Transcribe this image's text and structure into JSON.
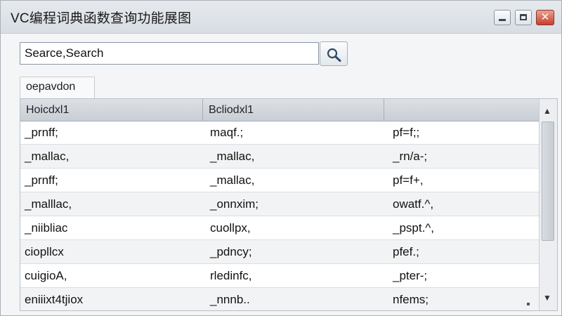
{
  "window": {
    "title": "VC编程词典函数查询功能展图"
  },
  "search": {
    "value": "Searce,Search",
    "placeholder": ""
  },
  "icons": {
    "search_button": "search-icon",
    "minimize": "minimize-icon",
    "maximize": "maximize-icon",
    "close": "close-icon"
  },
  "tab": {
    "label": "oepavdon"
  },
  "table": {
    "headers": [
      "Hoicdxl1",
      "Bcliodxl1",
      ""
    ],
    "rows": [
      [
        "_prnff;",
        "maqf.;",
        "pf=f;;"
      ],
      [
        "_mallac,",
        "_mallac,",
        "_rn/a-;"
      ],
      [
        "_prnff;",
        "_mallac,",
        "pf=f+,"
      ],
      [
        "_malllac,",
        "_onnxim;",
        "owatf.^,"
      ],
      [
        "_niibliac",
        "cuollpx,",
        "_pspt.^,"
      ],
      [
        "ciopllcx",
        "_pdncy;",
        "pfef.;"
      ],
      [
        "cuigioA,",
        "rledinfc,",
        "_pter-;"
      ],
      [
        "eniiixt4tjiox",
        "_nnnb..",
        "nfems;"
      ]
    ]
  },
  "scroll": {
    "up_arrow": "▲",
    "down_arrow": "▼"
  },
  "colors": {
    "accent_close": "#c4412c",
    "header_bg": "#c9ced4"
  }
}
